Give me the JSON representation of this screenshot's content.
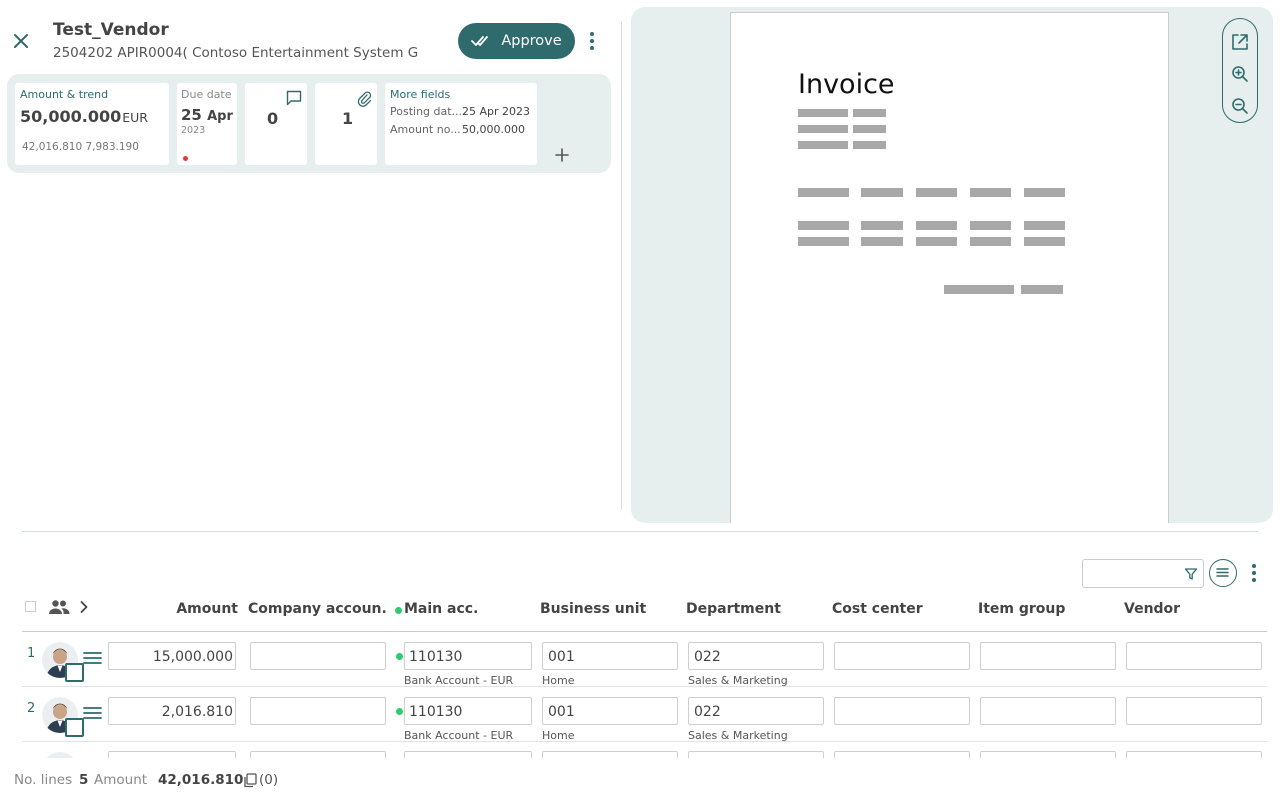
{
  "header": {
    "title": "Test_Vendor",
    "subtitle": "2504202 APIR0004( Contoso Entertainment System G",
    "approve_label": "Approve"
  },
  "cards": {
    "amount": {
      "label": "Amount & trend",
      "value": "50,000.000",
      "currency": "EUR",
      "trend": "42,016.810 7,983.190"
    },
    "due": {
      "label": "Due date",
      "day": "25",
      "month": "Apr",
      "year": "2023"
    },
    "comments": {
      "count": "0"
    },
    "attachments": {
      "count": "1"
    },
    "more": {
      "label": "More fields",
      "rows": [
        {
          "key": "Posting dat...",
          "value": "25 Apr 2023"
        },
        {
          "key": "Amount no...",
          "value": "50,000.000"
        }
      ]
    }
  },
  "preview": {
    "doc_title": "Invoice"
  },
  "grid": {
    "columns": {
      "amount": "Amount",
      "company": "Company accoun...",
      "main": "Main acc.",
      "business_unit": "Business unit",
      "department": "Department",
      "cost_center": "Cost center",
      "item_group": "Item group",
      "vendor": "Vendor"
    },
    "rows": [
      {
        "num": "1",
        "amount": "15,000.000",
        "main": "110130",
        "main_desc": "Bank Account - EUR",
        "bu": "001",
        "bu_desc": "Home",
        "dept": "022",
        "dept_desc": "Sales & Marketing"
      },
      {
        "num": "2",
        "amount": "2,016.810",
        "main": "110130",
        "main_desc": "Bank Account - EUR",
        "bu": "001",
        "bu_desc": "Home",
        "dept": "022",
        "dept_desc": "Sales & Marketing"
      }
    ]
  },
  "footer": {
    "lines_label": "No. lines",
    "lines_value": "5",
    "amount_label": "Amount",
    "amount_value": "42,016.810",
    "copy_count": "(0)"
  },
  "colors": {
    "accent": "#2f6b6d",
    "panel": "#e6efee",
    "status_green": "#2ecc71",
    "due_dot": "#e53935"
  }
}
